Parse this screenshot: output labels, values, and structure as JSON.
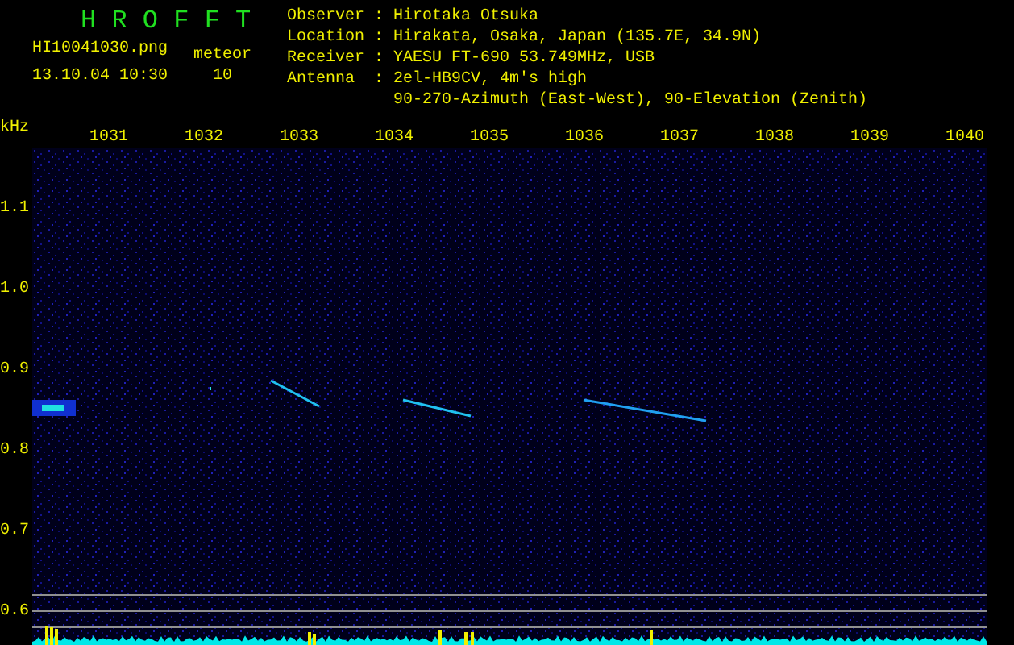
{
  "header": {
    "program": "H R O F F T",
    "filename": "HI10041030.png",
    "timestamp": "13.10.04 10:30",
    "counter_label": "meteor",
    "counter_value": "10"
  },
  "station_info": [
    {
      "label": "Observer :",
      "value": "Hirotaka Otsuka"
    },
    {
      "label": "Location :",
      "value": "Hirakata, Osaka, Japan (135.7E, 34.9N)"
    },
    {
      "label": "Receiver :",
      "value": "YAESU FT-690 53.749MHz, USB"
    },
    {
      "label": "Antenna  :",
      "value": "2el-HB9CV, 4m's high",
      "continuation": "90-270-Azimuth (East-West), 90-Elevation (Zenith)"
    }
  ],
  "plot": {
    "y_unit": "kHz",
    "x_labels": [
      "1031",
      "1032",
      "1033",
      "1034",
      "1035",
      "1036",
      "1037",
      "1038",
      "1039",
      "1040"
    ],
    "y_labels": [
      "1.1",
      "1.0",
      "0.9",
      "0.8",
      "0.7",
      "0.6"
    ]
  }
}
